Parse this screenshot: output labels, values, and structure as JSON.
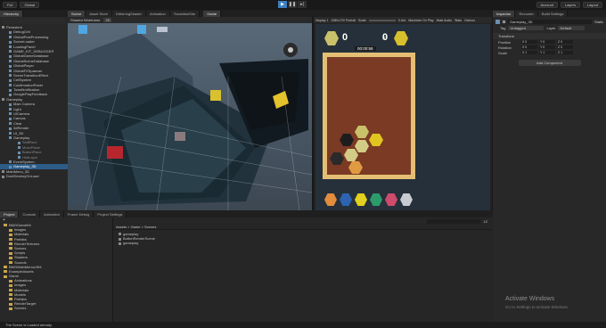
{
  "topbar": {
    "account_label": "FixI",
    "global_label": "Global",
    "right_buttons": [
      "Account",
      "Layers",
      "Layout"
    ]
  },
  "scene_tabs": [
    "Scene",
    "Asset Store",
    "DitheringShader",
    "Animation",
    "TransitionShe",
    "Game"
  ],
  "hierarchy": {
    "tab": "Hierarchy",
    "items": [
      {
        "label": "Persistent",
        "type": "scene"
      },
      {
        "label": "DebugCell",
        "type": "obj"
      },
      {
        "label": "GlobalPostProcessing",
        "type": "obj"
      },
      {
        "label": "SceneLoader",
        "type": "obj"
      },
      {
        "label": "LoadingPanel",
        "type": "obj"
      },
      {
        "label": "GAME_KIT_DEBUGGER",
        "type": "obj"
      },
      {
        "label": "GlobalGameDatabase",
        "type": "obj"
      },
      {
        "label": "GlobalSceneDatabase",
        "type": "obj"
      },
      {
        "label": "GlobalPlayer",
        "type": "obj"
      },
      {
        "label": "GlobalFXSpawner",
        "type": "obj"
      },
      {
        "label": "SceneTransitionEffect",
        "type": "obj"
      },
      {
        "label": "CellSystem",
        "type": "obj"
      },
      {
        "label": "ConfirmationPanel",
        "type": "obj"
      },
      {
        "label": "ToastNotification",
        "type": "obj"
      },
      {
        "label": "GooglePlayFeedback",
        "type": "obj"
      },
      {
        "label": "Gameplay",
        "type": "scene"
      },
      {
        "label": "Main Camera",
        "type": "obj"
      },
      {
        "label": "Light",
        "type": "obj"
      },
      {
        "label": "UICamera",
        "type": "obj"
      },
      {
        "label": "Canvas",
        "type": "obj"
      },
      {
        "label": "Clear",
        "type": "obj"
      },
      {
        "label": "3dRender",
        "type": "obj"
      },
      {
        "label": "UI_3D",
        "type": "obj"
      },
      {
        "label": "Gameplay",
        "type": "obj"
      },
      {
        "label": "ShiftRect",
        "type": "dim"
      },
      {
        "label": "MovePlace",
        "type": "dim"
      },
      {
        "label": "ButtonPlace",
        "type": "dim"
      },
      {
        "label": "HintLayer",
        "type": "dim"
      },
      {
        "label": "EventSystem",
        "type": "obj"
      },
      {
        "label": "Gameplay_3D",
        "type": "sel"
      },
      {
        "label": "MainMenu_3D",
        "type": "scene"
      },
      {
        "label": "DontDestroyOnLoad",
        "type": "scene"
      }
    ]
  },
  "scene_toolbar": {
    "shading": "Shaded Wireframe",
    "mode": "2D"
  },
  "game_toolbar": {
    "display": "Display 1",
    "resolution": "1080x720 Portrait",
    "scale_label": "Scale",
    "scale_value": "0.44x",
    "options": [
      "Maximize On Play",
      "Mute Audio",
      "Stats",
      "Gizmos"
    ]
  },
  "game": {
    "score_left": "0",
    "score_right": "0",
    "timer": "00:00:58"
  },
  "inspector": {
    "tabs": [
      "Inspector",
      "Recorder",
      "Build Settings"
    ],
    "object_name": "Gameplay_3D",
    "static_label": "Static",
    "tag_label": "Tag",
    "tag_value": "Untagged",
    "layer_label": "Layer",
    "layer_value": "Default",
    "component": "Transform",
    "fields": [
      {
        "label": "Position",
        "x": "X  0",
        "y": "Y  0",
        "z": "Z  0"
      },
      {
        "label": "Rotation",
        "x": "X  0",
        "y": "Y  0",
        "z": "Z  0"
      },
      {
        "label": "Scale",
        "x": "X  1",
        "y": "Y  1",
        "z": "Z  1"
      }
    ],
    "add_component": "Add Component"
  },
  "bottom_tabs": [
    "Project",
    "Console",
    "Animation",
    "Frame Debug",
    "Project Settings"
  ],
  "project": {
    "tree": [
      {
        "label": "BMGGameKit",
        "indent": 0
      },
      {
        "label": "Images",
        "indent": 1
      },
      {
        "label": "Materials",
        "indent": 1
      },
      {
        "label": "Prefabs",
        "indent": 1
      },
      {
        "label": "RenderTextures",
        "indent": 1
      },
      {
        "label": "Scenes",
        "indent": 1
      },
      {
        "label": "Scripts",
        "indent": 1
      },
      {
        "label": "Shaders",
        "indent": 1
      },
      {
        "label": "Sounds",
        "indent": 1
      },
      {
        "label": "BMGMainMenuUIKit",
        "indent": 0
      },
      {
        "label": "ExampleAssets",
        "indent": 0
      },
      {
        "label": "Game",
        "indent": 0
      },
      {
        "label": "Animations",
        "indent": 1
      },
      {
        "label": "Images",
        "indent": 1
      },
      {
        "label": "Materials",
        "indent": 1
      },
      {
        "label": "Models",
        "indent": 1
      },
      {
        "label": "Prefabs",
        "indent": 1
      },
      {
        "label": "RenderTarget",
        "indent": 1
      },
      {
        "label": "Scenes",
        "indent": 1
      }
    ],
    "breadcrumb": "Assets > Game > Scenes",
    "files": [
      "gameplay",
      "ButtonRenderScene",
      "gameplay"
    ],
    "item_count": "12"
  },
  "watermark": {
    "title": "Activate Windows",
    "subtitle": "Go to Settings to activate Windows."
  },
  "status": "The Scene is Loaded already",
  "colors": {
    "accent": "#3e7fc0",
    "selection": "#2c5d87",
    "board": "#7a3a24"
  }
}
